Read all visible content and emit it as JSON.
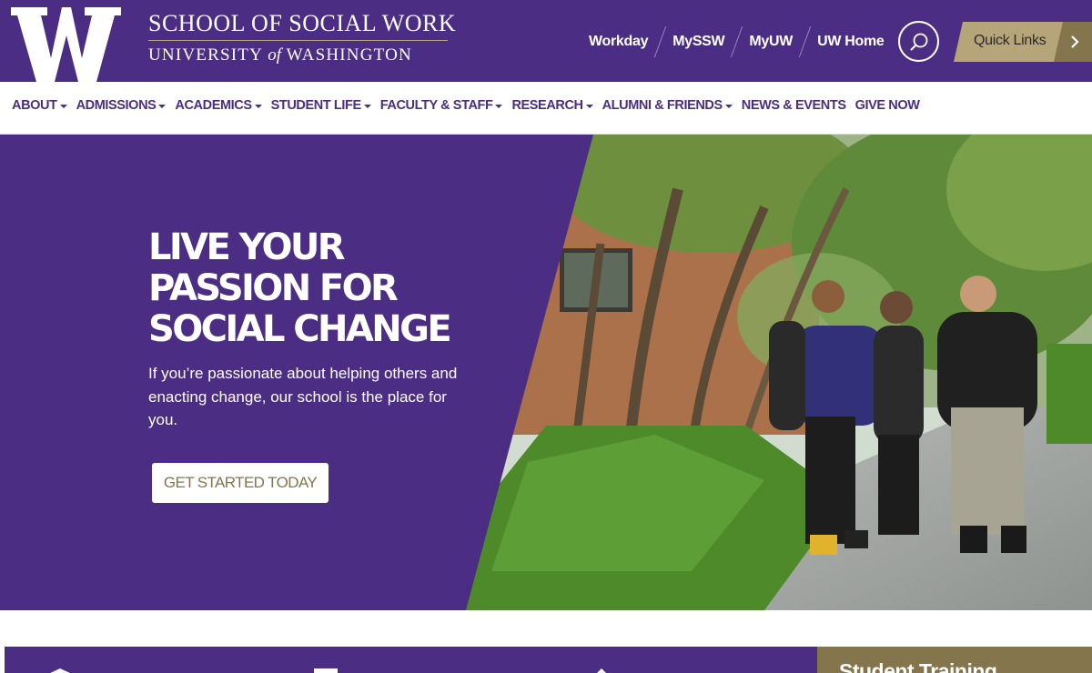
{
  "header": {
    "logo_icon": "uw-w-logo",
    "school_name": "SCHOOL OF SOCIAL WORK",
    "university_pre": "UNIVERSITY ",
    "university_of": "of",
    "university_post": " WASHINGTON",
    "utility_links": [
      "Workday",
      "MySSW",
      "MyUW",
      "UW Home"
    ],
    "search_icon": "search-icon",
    "quick_links_label": "Quick Links",
    "quick_links_icon": "chevron-right-icon"
  },
  "nav": {
    "items": [
      {
        "label": "ABOUT",
        "has_menu": true
      },
      {
        "label": "ADMISSIONS",
        "has_menu": true
      },
      {
        "label": "ACADEMICS",
        "has_menu": true
      },
      {
        "label": "STUDENT LIFE",
        "has_menu": true
      },
      {
        "label": "FACULTY & STAFF",
        "has_menu": true
      },
      {
        "label": "RESEARCH",
        "has_menu": true
      },
      {
        "label": "ALUMNI & FRIENDS",
        "has_menu": true
      },
      {
        "label": "NEWS & EVENTS",
        "has_menu": false
      },
      {
        "label": "GIVE NOW",
        "has_menu": false
      }
    ]
  },
  "hero": {
    "title_line1": "LIVE YOUR",
    "title_line2": "PASSION FOR",
    "title_line3": "SOCIAL CHANGE",
    "text": "If you’re passionate about helping others and enacting change, our school is the place for you.",
    "cta_label": "GET STARTED TODAY"
  },
  "bottom": {
    "feature_icons": [
      "graduation-cap-icon",
      "book-icon",
      "diamond-icon"
    ],
    "gold_heading": "Student Training"
  },
  "colors": {
    "uw_purple": "#4b2e83",
    "uw_gold": "#b7a57a",
    "uw_dark_gold": "#85754d",
    "white": "#ffffff"
  }
}
